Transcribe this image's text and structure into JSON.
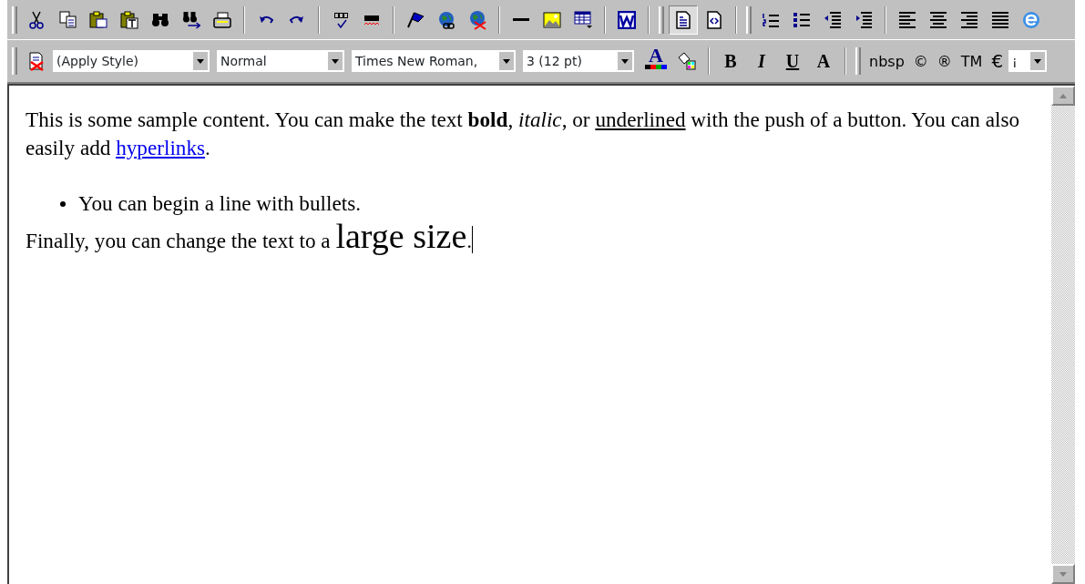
{
  "toolbars": [
    {
      "items": [
        {
          "kind": "grip"
        },
        {
          "kind": "button",
          "selected": false
        },
        {
          "kind": "button",
          "selected": false
        },
        {
          "kind": "button",
          "selected": false
        },
        {
          "kind": "button",
          "selected": false
        },
        {
          "kind": "button",
          "selected": false
        },
        {
          "kind": "button",
          "selected": false
        },
        {
          "kind": "button",
          "selected": false
        },
        {
          "kind": "separator"
        },
        {
          "kind": "button",
          "selected": false
        },
        {
          "kind": "button",
          "selected": false
        },
        {
          "kind": "separator"
        },
        {
          "kind": "button",
          "selected": false
        },
        {
          "kind": "button",
          "selected": false
        },
        {
          "kind": "separator"
        },
        {
          "kind": "button",
          "selected": false
        },
        {
          "kind": "button",
          "selected": false
        },
        {
          "kind": "button",
          "selected": false
        },
        {
          "kind": "separator"
        },
        {
          "kind": "button",
          "selected": false
        },
        {
          "kind": "button",
          "selected": false
        },
        {
          "kind": "button",
          "selected": false
        },
        {
          "kind": "separator"
        },
        {
          "kind": "button",
          "selected": false
        },
        {
          "kind": "separator"
        },
        {
          "kind": "grip"
        },
        {
          "kind": "button",
          "selected": true
        },
        {
          "kind": "button",
          "selected": false
        },
        {
          "kind": "separator"
        },
        {
          "kind": "grip"
        },
        {
          "kind": "button",
          "selected": false
        },
        {
          "kind": "button",
          "selected": false
        },
        {
          "kind": "button",
          "selected": false
        },
        {
          "kind": "button",
          "selected": false
        },
        {
          "kind": "separator"
        },
        {
          "kind": "button",
          "selected": false
        },
        {
          "kind": "button",
          "selected": false
        },
        {
          "kind": "button",
          "selected": false
        },
        {
          "kind": "button",
          "selected": false
        },
        {
          "kind": "button",
          "selected": false
        }
      ]
    },
    {
      "items": [
        {
          "kind": "grip"
        },
        {
          "kind": "button",
          "selected": false
        },
        {
          "kind": "select",
          "value": "(Apply Style)"
        },
        {
          "kind": "select",
          "value": "Normal"
        },
        {
          "kind": "select",
          "value": "Times New Roman,"
        },
        {
          "kind": "select",
          "value": "3 (12 pt)"
        },
        {
          "kind": "color-letter",
          "label": "A"
        },
        {
          "kind": "button",
          "selected": false
        },
        {
          "kind": "separator"
        },
        {
          "kind": "letter",
          "label": "B"
        },
        {
          "kind": "letter",
          "label": "I"
        },
        {
          "kind": "letter",
          "label": "U"
        },
        {
          "kind": "letter",
          "label": "A"
        },
        {
          "kind": "separator"
        },
        {
          "kind": "grip"
        },
        {
          "kind": "char",
          "label": "nbsp"
        },
        {
          "kind": "char",
          "label": "©"
        },
        {
          "kind": "char",
          "label": "®"
        },
        {
          "kind": "char",
          "label": "TM"
        },
        {
          "kind": "char-menu",
          "label": "€"
        },
        {
          "kind": "select",
          "value": "¡"
        }
      ]
    }
  ],
  "editor": {
    "blocks": [
      {
        "kind": "paragraph",
        "segments": [
          {
            "kind": "plain",
            "text": "This is some sample content. You can make the text "
          },
          {
            "kind": "bold",
            "text": "bold"
          },
          {
            "kind": "plain",
            "text": ", "
          },
          {
            "kind": "italic",
            "text": "italic"
          },
          {
            "kind": "plain",
            "text": ", or "
          },
          {
            "kind": "underline",
            "text": "underlined"
          },
          {
            "kind": "plain",
            "text": " with the push of a button. You can also easily add "
          },
          {
            "kind": "link",
            "text": "hyperlinks"
          },
          {
            "kind": "plain",
            "text": "."
          }
        ]
      },
      {
        "kind": "bullet",
        "segments": [
          {
            "kind": "plain",
            "text": "You can begin a line with bullets."
          }
        ]
      },
      {
        "kind": "line",
        "segments": [
          {
            "kind": "plain",
            "text": "Finally, you can change the text to a "
          },
          {
            "kind": "large",
            "text": "large size"
          },
          {
            "kind": "plain",
            "text": "."
          }
        ]
      }
    ]
  }
}
